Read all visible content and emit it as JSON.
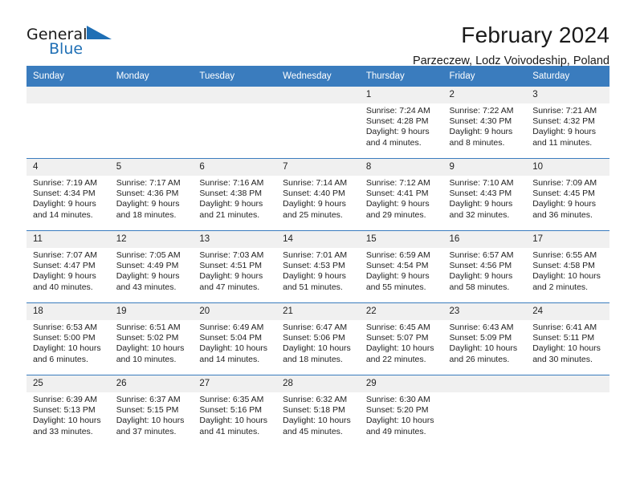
{
  "brand": {
    "name_part1": "General",
    "name_part2": "Blue",
    "flag_icon": "blue-triangle-flag-icon"
  },
  "header": {
    "month_title": "February 2024",
    "location": "Parzeczew, Lodz Voivodeship, Poland"
  },
  "colors": {
    "header_blue": "#3a7cbe",
    "brand_blue": "#1f6fb5",
    "daynum_band": "#f0f0f0",
    "text": "#222222"
  },
  "weekday_headers": [
    "Sunday",
    "Monday",
    "Tuesday",
    "Wednesday",
    "Thursday",
    "Friday",
    "Saturday"
  ],
  "weeks": [
    [
      {
        "day": "",
        "empty": true,
        "sunrise": "",
        "sunset": "",
        "daylight_line1": "",
        "daylight_line2": ""
      },
      {
        "day": "",
        "empty": true,
        "sunrise": "",
        "sunset": "",
        "daylight_line1": "",
        "daylight_line2": ""
      },
      {
        "day": "",
        "empty": true,
        "sunrise": "",
        "sunset": "",
        "daylight_line1": "",
        "daylight_line2": ""
      },
      {
        "day": "",
        "empty": true,
        "sunrise": "",
        "sunset": "",
        "daylight_line1": "",
        "daylight_line2": ""
      },
      {
        "day": "1",
        "sunrise": "Sunrise: 7:24 AM",
        "sunset": "Sunset: 4:28 PM",
        "daylight_line1": "Daylight: 9 hours",
        "daylight_line2": "and 4 minutes."
      },
      {
        "day": "2",
        "sunrise": "Sunrise: 7:22 AM",
        "sunset": "Sunset: 4:30 PM",
        "daylight_line1": "Daylight: 9 hours",
        "daylight_line2": "and 8 minutes."
      },
      {
        "day": "3",
        "sunrise": "Sunrise: 7:21 AM",
        "sunset": "Sunset: 4:32 PM",
        "daylight_line1": "Daylight: 9 hours",
        "daylight_line2": "and 11 minutes."
      }
    ],
    [
      {
        "day": "4",
        "sunrise": "Sunrise: 7:19 AM",
        "sunset": "Sunset: 4:34 PM",
        "daylight_line1": "Daylight: 9 hours",
        "daylight_line2": "and 14 minutes."
      },
      {
        "day": "5",
        "sunrise": "Sunrise: 7:17 AM",
        "sunset": "Sunset: 4:36 PM",
        "daylight_line1": "Daylight: 9 hours",
        "daylight_line2": "and 18 minutes."
      },
      {
        "day": "6",
        "sunrise": "Sunrise: 7:16 AM",
        "sunset": "Sunset: 4:38 PM",
        "daylight_line1": "Daylight: 9 hours",
        "daylight_line2": "and 21 minutes."
      },
      {
        "day": "7",
        "sunrise": "Sunrise: 7:14 AM",
        "sunset": "Sunset: 4:40 PM",
        "daylight_line1": "Daylight: 9 hours",
        "daylight_line2": "and 25 minutes."
      },
      {
        "day": "8",
        "sunrise": "Sunrise: 7:12 AM",
        "sunset": "Sunset: 4:41 PM",
        "daylight_line1": "Daylight: 9 hours",
        "daylight_line2": "and 29 minutes."
      },
      {
        "day": "9",
        "sunrise": "Sunrise: 7:10 AM",
        "sunset": "Sunset: 4:43 PM",
        "daylight_line1": "Daylight: 9 hours",
        "daylight_line2": "and 32 minutes."
      },
      {
        "day": "10",
        "sunrise": "Sunrise: 7:09 AM",
        "sunset": "Sunset: 4:45 PM",
        "daylight_line1": "Daylight: 9 hours",
        "daylight_line2": "and 36 minutes."
      }
    ],
    [
      {
        "day": "11",
        "sunrise": "Sunrise: 7:07 AM",
        "sunset": "Sunset: 4:47 PM",
        "daylight_line1": "Daylight: 9 hours",
        "daylight_line2": "and 40 minutes."
      },
      {
        "day": "12",
        "sunrise": "Sunrise: 7:05 AM",
        "sunset": "Sunset: 4:49 PM",
        "daylight_line1": "Daylight: 9 hours",
        "daylight_line2": "and 43 minutes."
      },
      {
        "day": "13",
        "sunrise": "Sunrise: 7:03 AM",
        "sunset": "Sunset: 4:51 PM",
        "daylight_line1": "Daylight: 9 hours",
        "daylight_line2": "and 47 minutes."
      },
      {
        "day": "14",
        "sunrise": "Sunrise: 7:01 AM",
        "sunset": "Sunset: 4:53 PM",
        "daylight_line1": "Daylight: 9 hours",
        "daylight_line2": "and 51 minutes."
      },
      {
        "day": "15",
        "sunrise": "Sunrise: 6:59 AM",
        "sunset": "Sunset: 4:54 PM",
        "daylight_line1": "Daylight: 9 hours",
        "daylight_line2": "and 55 minutes."
      },
      {
        "day": "16",
        "sunrise": "Sunrise: 6:57 AM",
        "sunset": "Sunset: 4:56 PM",
        "daylight_line1": "Daylight: 9 hours",
        "daylight_line2": "and 58 minutes."
      },
      {
        "day": "17",
        "sunrise": "Sunrise: 6:55 AM",
        "sunset": "Sunset: 4:58 PM",
        "daylight_line1": "Daylight: 10 hours",
        "daylight_line2": "and 2 minutes."
      }
    ],
    [
      {
        "day": "18",
        "sunrise": "Sunrise: 6:53 AM",
        "sunset": "Sunset: 5:00 PM",
        "daylight_line1": "Daylight: 10 hours",
        "daylight_line2": "and 6 minutes."
      },
      {
        "day": "19",
        "sunrise": "Sunrise: 6:51 AM",
        "sunset": "Sunset: 5:02 PM",
        "daylight_line1": "Daylight: 10 hours",
        "daylight_line2": "and 10 minutes."
      },
      {
        "day": "20",
        "sunrise": "Sunrise: 6:49 AM",
        "sunset": "Sunset: 5:04 PM",
        "daylight_line1": "Daylight: 10 hours",
        "daylight_line2": "and 14 minutes."
      },
      {
        "day": "21",
        "sunrise": "Sunrise: 6:47 AM",
        "sunset": "Sunset: 5:06 PM",
        "daylight_line1": "Daylight: 10 hours",
        "daylight_line2": "and 18 minutes."
      },
      {
        "day": "22",
        "sunrise": "Sunrise: 6:45 AM",
        "sunset": "Sunset: 5:07 PM",
        "daylight_line1": "Daylight: 10 hours",
        "daylight_line2": "and 22 minutes."
      },
      {
        "day": "23",
        "sunrise": "Sunrise: 6:43 AM",
        "sunset": "Sunset: 5:09 PM",
        "daylight_line1": "Daylight: 10 hours",
        "daylight_line2": "and 26 minutes."
      },
      {
        "day": "24",
        "sunrise": "Sunrise: 6:41 AM",
        "sunset": "Sunset: 5:11 PM",
        "daylight_line1": "Daylight: 10 hours",
        "daylight_line2": "and 30 minutes."
      }
    ],
    [
      {
        "day": "25",
        "sunrise": "Sunrise: 6:39 AM",
        "sunset": "Sunset: 5:13 PM",
        "daylight_line1": "Daylight: 10 hours",
        "daylight_line2": "and 33 minutes."
      },
      {
        "day": "26",
        "sunrise": "Sunrise: 6:37 AM",
        "sunset": "Sunset: 5:15 PM",
        "daylight_line1": "Daylight: 10 hours",
        "daylight_line2": "and 37 minutes."
      },
      {
        "day": "27",
        "sunrise": "Sunrise: 6:35 AM",
        "sunset": "Sunset: 5:16 PM",
        "daylight_line1": "Daylight: 10 hours",
        "daylight_line2": "and 41 minutes."
      },
      {
        "day": "28",
        "sunrise": "Sunrise: 6:32 AM",
        "sunset": "Sunset: 5:18 PM",
        "daylight_line1": "Daylight: 10 hours",
        "daylight_line2": "and 45 minutes."
      },
      {
        "day": "29",
        "sunrise": "Sunrise: 6:30 AM",
        "sunset": "Sunset: 5:20 PM",
        "daylight_line1": "Daylight: 10 hours",
        "daylight_line2": "and 49 minutes."
      },
      {
        "day": "",
        "empty": true,
        "sunrise": "",
        "sunset": "",
        "daylight_line1": "",
        "daylight_line2": ""
      },
      {
        "day": "",
        "empty": true,
        "sunrise": "",
        "sunset": "",
        "daylight_line1": "",
        "daylight_line2": ""
      }
    ]
  ]
}
